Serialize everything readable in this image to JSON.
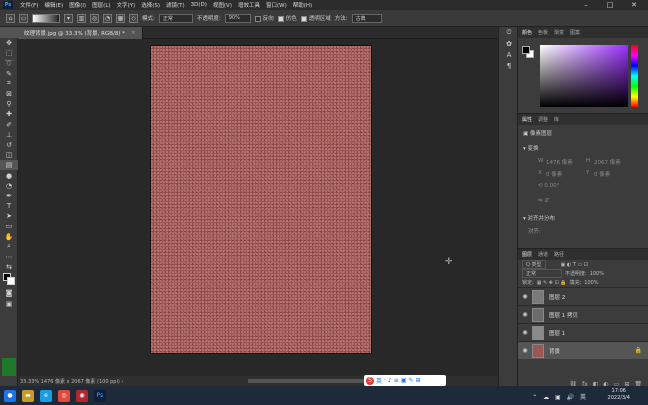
{
  "menubar": {
    "logo": "Ps",
    "items": [
      "文件(F)",
      "编辑(E)",
      "图像(I)",
      "图层(L)",
      "文字(Y)",
      "选择(S)",
      "滤镜(T)",
      "3D(D)",
      "视图(V)",
      "增效工具",
      "窗口(W)",
      "帮助(H)"
    ],
    "controls": [
      "–",
      "□",
      "✕"
    ]
  },
  "options": {
    "mode_label": "模式:",
    "mode_value": "正常",
    "opacity_label": "不透明度:",
    "opacity_value": "90%",
    "reverse_label": "反向",
    "dither_label": "仿色",
    "transparency_label": "透明区域",
    "method_label": "方法:",
    "method_value": "古典"
  },
  "document": {
    "tab_title": "纹理背景.jpg @ 33.3% (背景, RGB/8) *"
  },
  "status": {
    "text": "33.33%   1476 像素 x 2067 像素 (100 ppi)   ›"
  },
  "ime": {
    "logo": "S",
    "items": [
      "英",
      "·",
      "♪",
      "≡",
      "▣",
      "✎",
      "⊞"
    ]
  },
  "color_panel": {
    "tabs": [
      "颜色",
      "色板",
      "渐变",
      "图案"
    ],
    "accent": "#9b2fff"
  },
  "properties": {
    "tabs": [
      "属性",
      "调整",
      "库"
    ],
    "layer_type": "像素图层",
    "transform_title": "变换",
    "w_label": "W",
    "w_value": "1476 像素",
    "h_label": "H",
    "h_value": "2067 像素",
    "x_label": "X",
    "x_value": "0 像素",
    "y_label": "Y",
    "y_value": "0 像素",
    "rotation": "0.00°",
    "align_title": "对齐并分布",
    "align_sub": "对齐:"
  },
  "layers": {
    "tabs": [
      "图层",
      "通道",
      "路径"
    ],
    "filter_label": "Q 类型",
    "blend_mode": "正常",
    "opacity_label": "不透明度:",
    "opacity_value": "100%",
    "lock_label": "锁定:",
    "fill_label": "填充:",
    "fill_value": "100%",
    "items": [
      {
        "name": "图层 2",
        "thumb": "#7a7a7a"
      },
      {
        "name": "图层 1 拷贝",
        "thumb": "#6b6b6b"
      },
      {
        "name": "图层 1",
        "thumb": "#8a8a8a"
      },
      {
        "name": "背景",
        "thumb": "#9e5555"
      }
    ],
    "footer_icons": [
      "⛓",
      "fx",
      "◧",
      "◐",
      "▭",
      "⊞",
      "🗑"
    ]
  },
  "taskbar": {
    "time": "17:06",
    "date": "2022/3/4",
    "apps": [
      {
        "label": "●",
        "color": "#1e73e8"
      },
      {
        "label": "▬",
        "color": "#c89a2a"
      },
      {
        "label": "e",
        "color": "#1a9ee0"
      },
      {
        "label": "◎",
        "color": "#e04a3a"
      },
      {
        "label": "◉",
        "color": "#b0272e"
      },
      {
        "label": "Ps",
        "color": "#0f1f3a"
      }
    ],
    "tray_icons": "⌃ ☁ ▣ 🔊 英"
  }
}
